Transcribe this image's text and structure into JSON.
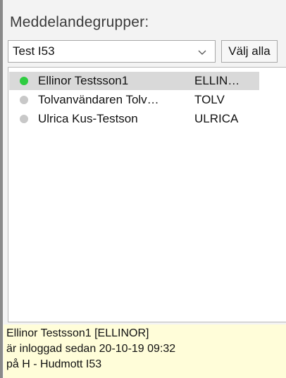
{
  "header": {
    "label": "Meddelandegrupper:"
  },
  "group_select": {
    "selected": "Test I53",
    "icon": "chevron-down-icon"
  },
  "toolbar": {
    "select_all_label": "Välj alla"
  },
  "users": [
    {
      "name": "Ellinor Testsson1",
      "id": "ELLIN…",
      "status_color": "#2ecc40",
      "selected": true
    },
    {
      "name": "Tolvanvändaren Tolv…",
      "id": "TOLV",
      "status_color": "#c8c8c8",
      "selected": false
    },
    {
      "name": "Ulrica Kus-Testson",
      "id": "ULRICA",
      "status_color": "#c8c8c8",
      "selected": false
    }
  ],
  "info": {
    "line1": "Ellinor Testsson1 [ELLINOR]",
    "line2": "är inloggad sedan 20-10-19 09:32",
    "line3": "på H - Hudmott I53"
  },
  "colors": {
    "info_background": "#fffdd9",
    "selected_row": "#d9d9d9",
    "online": "#2ecc40",
    "offline": "#c8c8c8"
  }
}
